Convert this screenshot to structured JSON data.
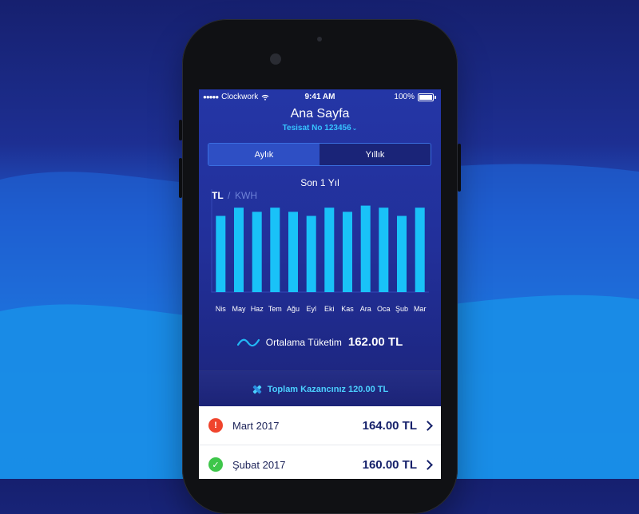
{
  "colors": {
    "bar": "#19c2f8",
    "bar_top": "#27d1ff",
    "accent": "#37c3ff",
    "screen_bg": "#22309a",
    "alert_red": "#f0442c",
    "ok_green": "#3ec64a"
  },
  "status_bar": {
    "carrier": "Clockwork",
    "time": "9:41 AM",
    "battery": "100%"
  },
  "header": {
    "title": "Ana Sayfa",
    "installation": "Tesisat No 123456"
  },
  "tabs": [
    {
      "label": "Aylık",
      "active": true
    },
    {
      "label": "Yıllık",
      "active": false
    }
  ],
  "chart": {
    "title": "Son 1 Yıl",
    "unit_tl": "TL",
    "unit_separator": "/",
    "unit_kwh": "KWH"
  },
  "chart_data": {
    "type": "bar",
    "categories": [
      "Nis",
      "May",
      "Haz",
      "Tem",
      "Ağu",
      "Eyl",
      "Eki",
      "Kas",
      "Ara",
      "Oca",
      "Şub",
      "Mar"
    ],
    "values": [
      148,
      164,
      156,
      164,
      156,
      148,
      164,
      156,
      168,
      164,
      148,
      164
    ],
    "ylim": [
      0,
      200
    ],
    "grid": false,
    "legend": "none"
  },
  "summary": {
    "avg_label": "Ortalama Tüketim",
    "avg_value": "162.00 TL",
    "gain_text": "Toplam Kazancınız 120.00 TL"
  },
  "bills": [
    {
      "month": "Mart 2017",
      "amount": "164.00 TL",
      "status": "alert",
      "icon": "exclamation-icon"
    },
    {
      "month": "Şubat 2017",
      "amount": "160.00 TL",
      "status": "paid",
      "icon": "check-icon"
    }
  ]
}
